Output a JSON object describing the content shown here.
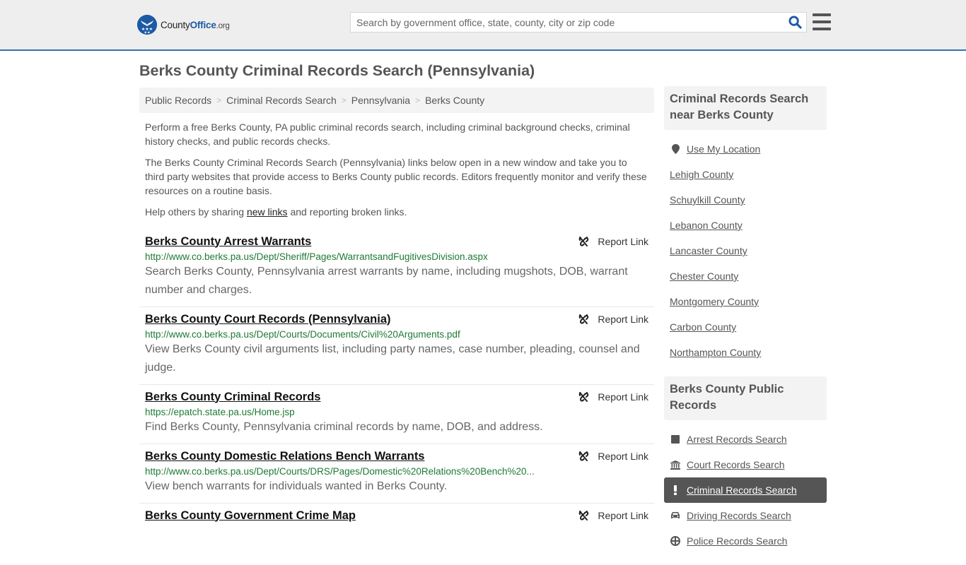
{
  "header": {
    "logo": {
      "name_part1": "County",
      "name_part2": "Office",
      "tld": ".org"
    },
    "search": {
      "placeholder": "Search by government office, state, county, city or zip code",
      "value": ""
    },
    "colors": {
      "brand": "#1c5aa5",
      "accent_border": "#3274b0"
    }
  },
  "page": {
    "title": "Berks County Criminal Records Search (Pennsylvania)"
  },
  "breadcrumb": [
    {
      "label": "Public Records"
    },
    {
      "label": "Criminal Records Search"
    },
    {
      "label": "Pennsylvania"
    },
    {
      "label": "Berks County"
    }
  ],
  "intro": {
    "p1": "Perform a free Berks County, PA public criminal records search, including criminal background checks, criminal history checks, and public records checks.",
    "p2": "The Berks County Criminal Records Search (Pennsylvania) links below open in a new window and take you to third party websites that provide access to Berks County public records. Editors frequently monitor and verify these resources on a routine basis.",
    "p3_before": "Help others by sharing ",
    "p3_link": "new links",
    "p3_after": " and reporting broken links."
  },
  "results": [
    {
      "title": "Berks County Arrest Warrants",
      "url": "http://www.co.berks.pa.us/Dept/Sheriff/Pages/WarrantsandFugitivesDivision.aspx",
      "description": "Search Berks County, Pennsylvania arrest warrants by name, including mugshots, DOB, warrant number and charges.",
      "report_label": "Report Link"
    },
    {
      "title": "Berks County Court Records (Pennsylvania)",
      "url": "http://www.co.berks.pa.us/Dept/Courts/Documents/Civil%20Arguments.pdf",
      "description": "View Berks County civil arguments list, including party names, case number, pleading, counsel and judge.",
      "report_label": "Report Link"
    },
    {
      "title": "Berks County Criminal Records",
      "url": "https://epatch.state.pa.us/Home.jsp",
      "description": "Find Berks County, Pennsylvania criminal records by name, DOB, and address.",
      "report_label": "Report Link"
    },
    {
      "title": "Berks County Domestic Relations Bench Warrants",
      "url": "http://www.co.berks.pa.us/Dept/Courts/DRS/Pages/Domestic%20Relations%20Bench%20...",
      "description": "View bench warrants for individuals wanted in Berks County.",
      "report_label": "Report Link"
    },
    {
      "title": "Berks County Government Crime Map",
      "url": "",
      "description": "",
      "report_label": "Report Link"
    }
  ],
  "sidebar": {
    "nearby": {
      "heading": "Criminal Records Search near Berks County",
      "use_location": {
        "label": "Use My Location",
        "icon": "map-marker-icon"
      },
      "items": [
        {
          "label": "Lehigh County"
        },
        {
          "label": "Schuylkill County"
        },
        {
          "label": "Lebanon County"
        },
        {
          "label": "Lancaster County"
        },
        {
          "label": "Chester County"
        },
        {
          "label": "Montgomery County"
        },
        {
          "label": "Carbon County"
        },
        {
          "label": "Northampton County"
        }
      ]
    },
    "public_records": {
      "heading": "Berks County Public Records",
      "items": [
        {
          "label": "Arrest Records Search",
          "icon": "square-icon",
          "active": false
        },
        {
          "label": "Court Records Search",
          "icon": "courthouse-icon",
          "active": false
        },
        {
          "label": "Criminal Records Search",
          "icon": "exclamation-icon",
          "active": true
        },
        {
          "label": "Driving Records Search",
          "icon": "car-icon",
          "active": false
        },
        {
          "label": "Police Records Search",
          "icon": "police-badge-icon",
          "active": false
        }
      ]
    }
  }
}
